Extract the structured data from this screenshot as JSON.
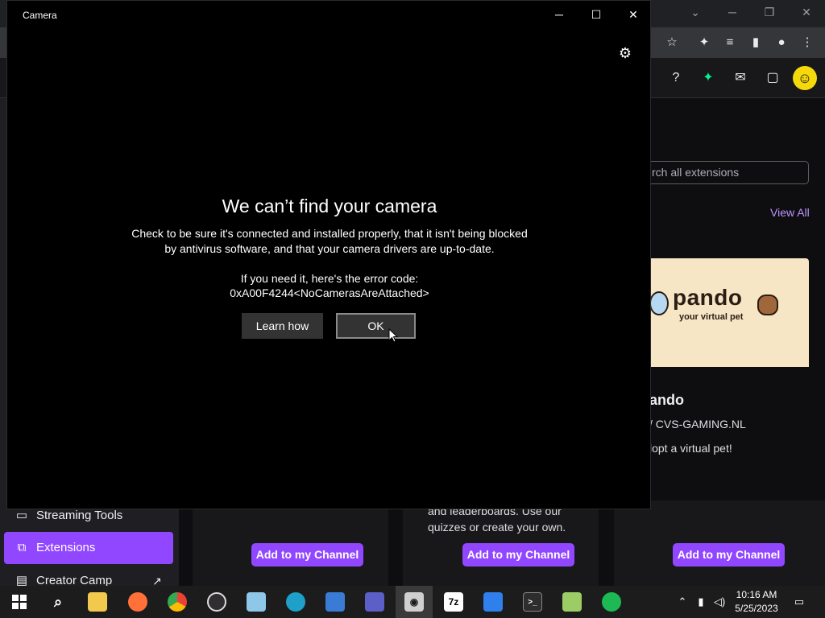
{
  "camera": {
    "title": "Camera",
    "controls": {
      "minimize": "─",
      "maximize": "☐",
      "close": "✕"
    },
    "settings_icon": "gear-icon",
    "error": {
      "heading": "We can’t find your camera",
      "line1": "Check to be sure it's connected and installed properly, that it isn't being blocked",
      "line2": "by antivirus software, and that your camera drivers are up-to-date.",
      "code_label": "If you need it, here's the error code:",
      "code": "0xA00F4244<NoCamerasAreAttached>"
    },
    "buttons": {
      "learn": "Learn how",
      "ok": "OK"
    }
  },
  "twitch": {
    "search_placeholder": "rch all extensions",
    "view_all": "View All",
    "pando": {
      "logo": "pando",
      "tagline": "your virtual pet",
      "name": "ando",
      "by": "/ CVS-GAMING.NL",
      "desc": "lopt a virtual pet!"
    },
    "sidebar": {
      "streaming_tools": "Streaming Tools",
      "extensions": "Extensions",
      "creator_camp": "Creator Camp"
    },
    "card_text_1": "and leaderboards. Use our",
    "card_text_2": "quizzes or create your own.",
    "add_button": "Add to my Channel"
  },
  "taskbar": {
    "clock_time": "10:16 AM",
    "clock_date": "5/25/2023",
    "apps": [
      "start",
      "search",
      "file-explorer",
      "firefox",
      "chrome",
      "obs",
      "notepad",
      "edge",
      "photos",
      "clipchamp",
      "camera",
      "7zip",
      "network",
      "terminal",
      "notepad-plus",
      "app-green"
    ]
  },
  "colors": {
    "twitch_purple": "#9147ff",
    "twitch_bg": "#0e0e10",
    "camera_bg": "#000000",
    "taskbar": "#1c1c1c"
  }
}
